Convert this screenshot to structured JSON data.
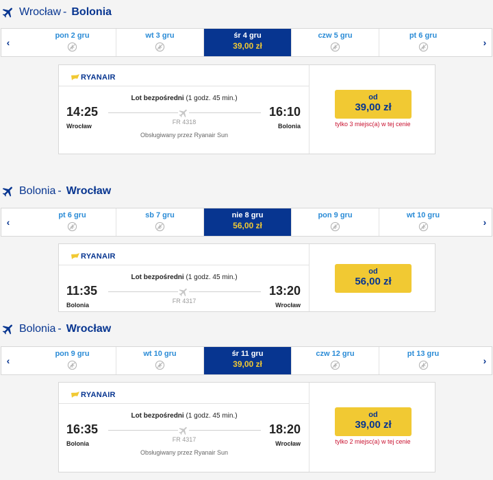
{
  "sections": [
    {
      "from": "Wrocław",
      "to": "Bolonia",
      "dash": "-",
      "days": [
        {
          "label": "pon 2 gru"
        },
        {
          "label": "wt 3 gru"
        },
        {
          "label": "śr 4 gru",
          "price": "39,00 zł",
          "active": true
        },
        {
          "label": "czw 5 gru"
        },
        {
          "label": "pt 6 gru"
        }
      ],
      "flight": {
        "airline": "RYANAIR",
        "direct_label": "Lot bezpośredni",
        "duration": "(1 godz. 45 min.)",
        "dep_time": "14:25",
        "dep_city": "Wrocław",
        "arr_time": "16:10",
        "arr_city": "Bolonia",
        "flight_no": "FR 4318",
        "operated_by": "Obsługiwany przez Ryanair Sun",
        "price_prefix": "od",
        "price": "39,00 zł",
        "seats_note": "tylko 3 miejsc(a) w tej cenie"
      }
    },
    {
      "from": "Bolonia",
      "to": "Wrocław",
      "dash": "-",
      "days": [
        {
          "label": "pt 6 gru"
        },
        {
          "label": "sb 7 gru"
        },
        {
          "label": "nie 8 gru",
          "price": "56,00 zł",
          "active": true
        },
        {
          "label": "pon 9 gru"
        },
        {
          "label": "wt 10 gru"
        }
      ],
      "flight": {
        "airline": "RYANAIR",
        "direct_label": "Lot bezpośredni",
        "duration": "(1 godz. 45 min.)",
        "dep_time": "11:35",
        "dep_city": "Bolonia",
        "arr_time": "13:20",
        "arr_city": "Wrocław",
        "flight_no": "FR 4317",
        "price_prefix": "od",
        "price": "56,00 zł"
      }
    },
    {
      "from": "Bolonia",
      "to": "Wrocław",
      "dash": "-",
      "days": [
        {
          "label": "pon 9 gru"
        },
        {
          "label": "wt 10 gru"
        },
        {
          "label": "śr 11 gru",
          "price": "39,00 zł",
          "active": true
        },
        {
          "label": "czw 12 gru"
        },
        {
          "label": "pt 13 gru"
        }
      ],
      "flight": {
        "airline": "RYANAIR",
        "direct_label": "Lot bezpośredni",
        "duration": "(1 godz. 45 min.)",
        "dep_time": "16:35",
        "dep_city": "Bolonia",
        "arr_time": "18:20",
        "arr_city": "Wrocław",
        "flight_no": "FR 4317",
        "operated_by": "Obsługiwany przez Ryanair Sun",
        "price_prefix": "od",
        "price": "39,00 zł",
        "seats_note": "tylko 2 miejsc(a) w tej cenie"
      }
    }
  ],
  "nav": {
    "prev": "‹",
    "next": "›"
  },
  "colors": {
    "brand": "#073590",
    "accent": "#f1c933",
    "link": "#2a8bd6",
    "warning": "#c8102e"
  },
  "icons": {
    "header": "plane-icon",
    "no_flight": "no-flight-icon",
    "route": "plane-icon",
    "airline": "ryanair-harp-logo"
  }
}
